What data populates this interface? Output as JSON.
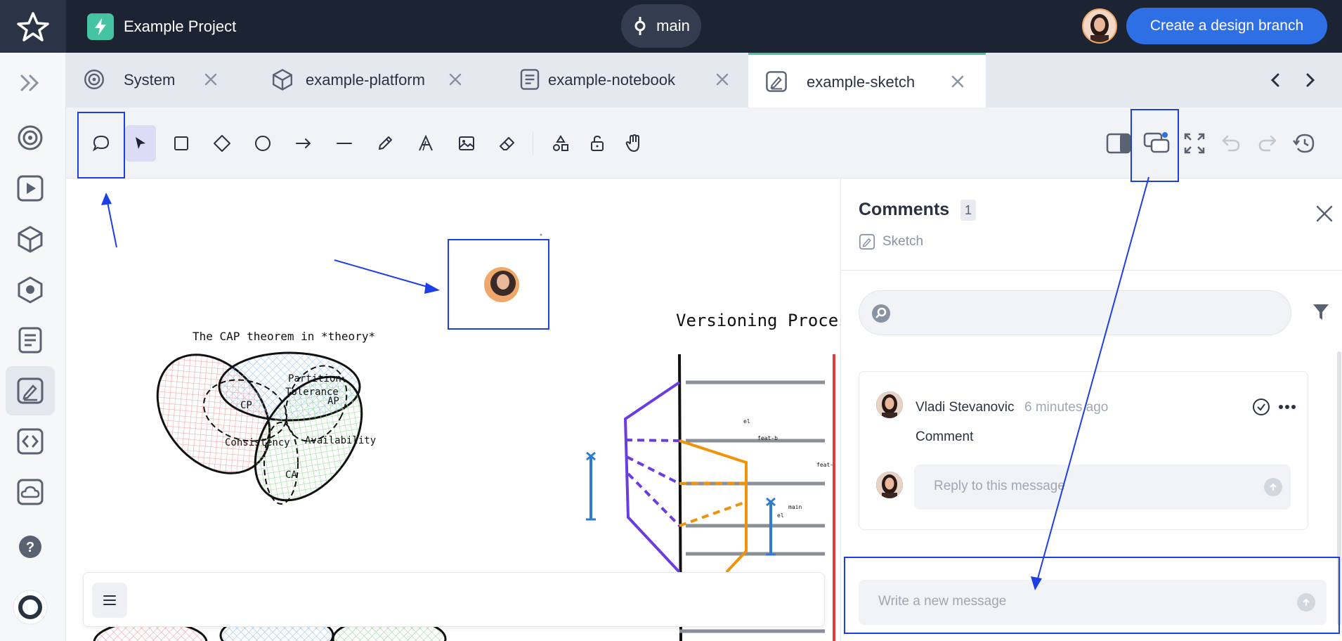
{
  "topbar": {
    "project_name": "Example Project",
    "branch": "main",
    "cta_label": "Create a design branch"
  },
  "tabs": [
    {
      "label": "System",
      "icon": "system-icon"
    },
    {
      "label": "example-platform",
      "icon": "cube-icon"
    },
    {
      "label": "example-notebook",
      "icon": "notebook-icon"
    },
    {
      "label": "example-sketch",
      "icon": "sketch-icon",
      "active": true
    }
  ],
  "rail": [
    "expand-icon",
    "system-icon",
    "play-icon",
    "cube-icon",
    "hexagon-icon",
    "notebook-icon",
    "sketch-icon",
    "code-icon",
    "cloud-icon",
    "help-icon",
    "support-icon"
  ],
  "toolbar": {
    "tools": [
      "comment",
      "select",
      "rectangle",
      "diamond",
      "ellipse",
      "arrow",
      "line",
      "pencil",
      "text",
      "image",
      "eraser",
      "shapes",
      "lock",
      "hand"
    ],
    "right": [
      "sidebar-toggle",
      "comments",
      "fullscreen",
      "undo",
      "redo",
      "history"
    ]
  },
  "canvas": {
    "cap_title": "The CAP theorem in *theory*",
    "cap_labels": [
      "Partition",
      "Tolerance",
      "CP",
      "AP",
      "Consistency",
      "Availability",
      "CA"
    ],
    "versioning_title": "Versioning Process",
    "small_labels": [
      "el",
      "feat-b",
      "feat-",
      "main",
      "el"
    ]
  },
  "comments": {
    "title": "Comments",
    "count": "1",
    "subtitle": "Sketch",
    "search_placeholder": "",
    "thread": {
      "author": "Vladi Stevanovic",
      "time": "6 minutes ago",
      "body": "Comment",
      "reply_placeholder": "Reply to this message"
    },
    "new_placeholder": "Write a new message"
  },
  "colors": {
    "topbar": "#1c2333",
    "accent": "#2f6fe6",
    "teal": "#46c3a3",
    "annotation": "#1f3fe6"
  }
}
